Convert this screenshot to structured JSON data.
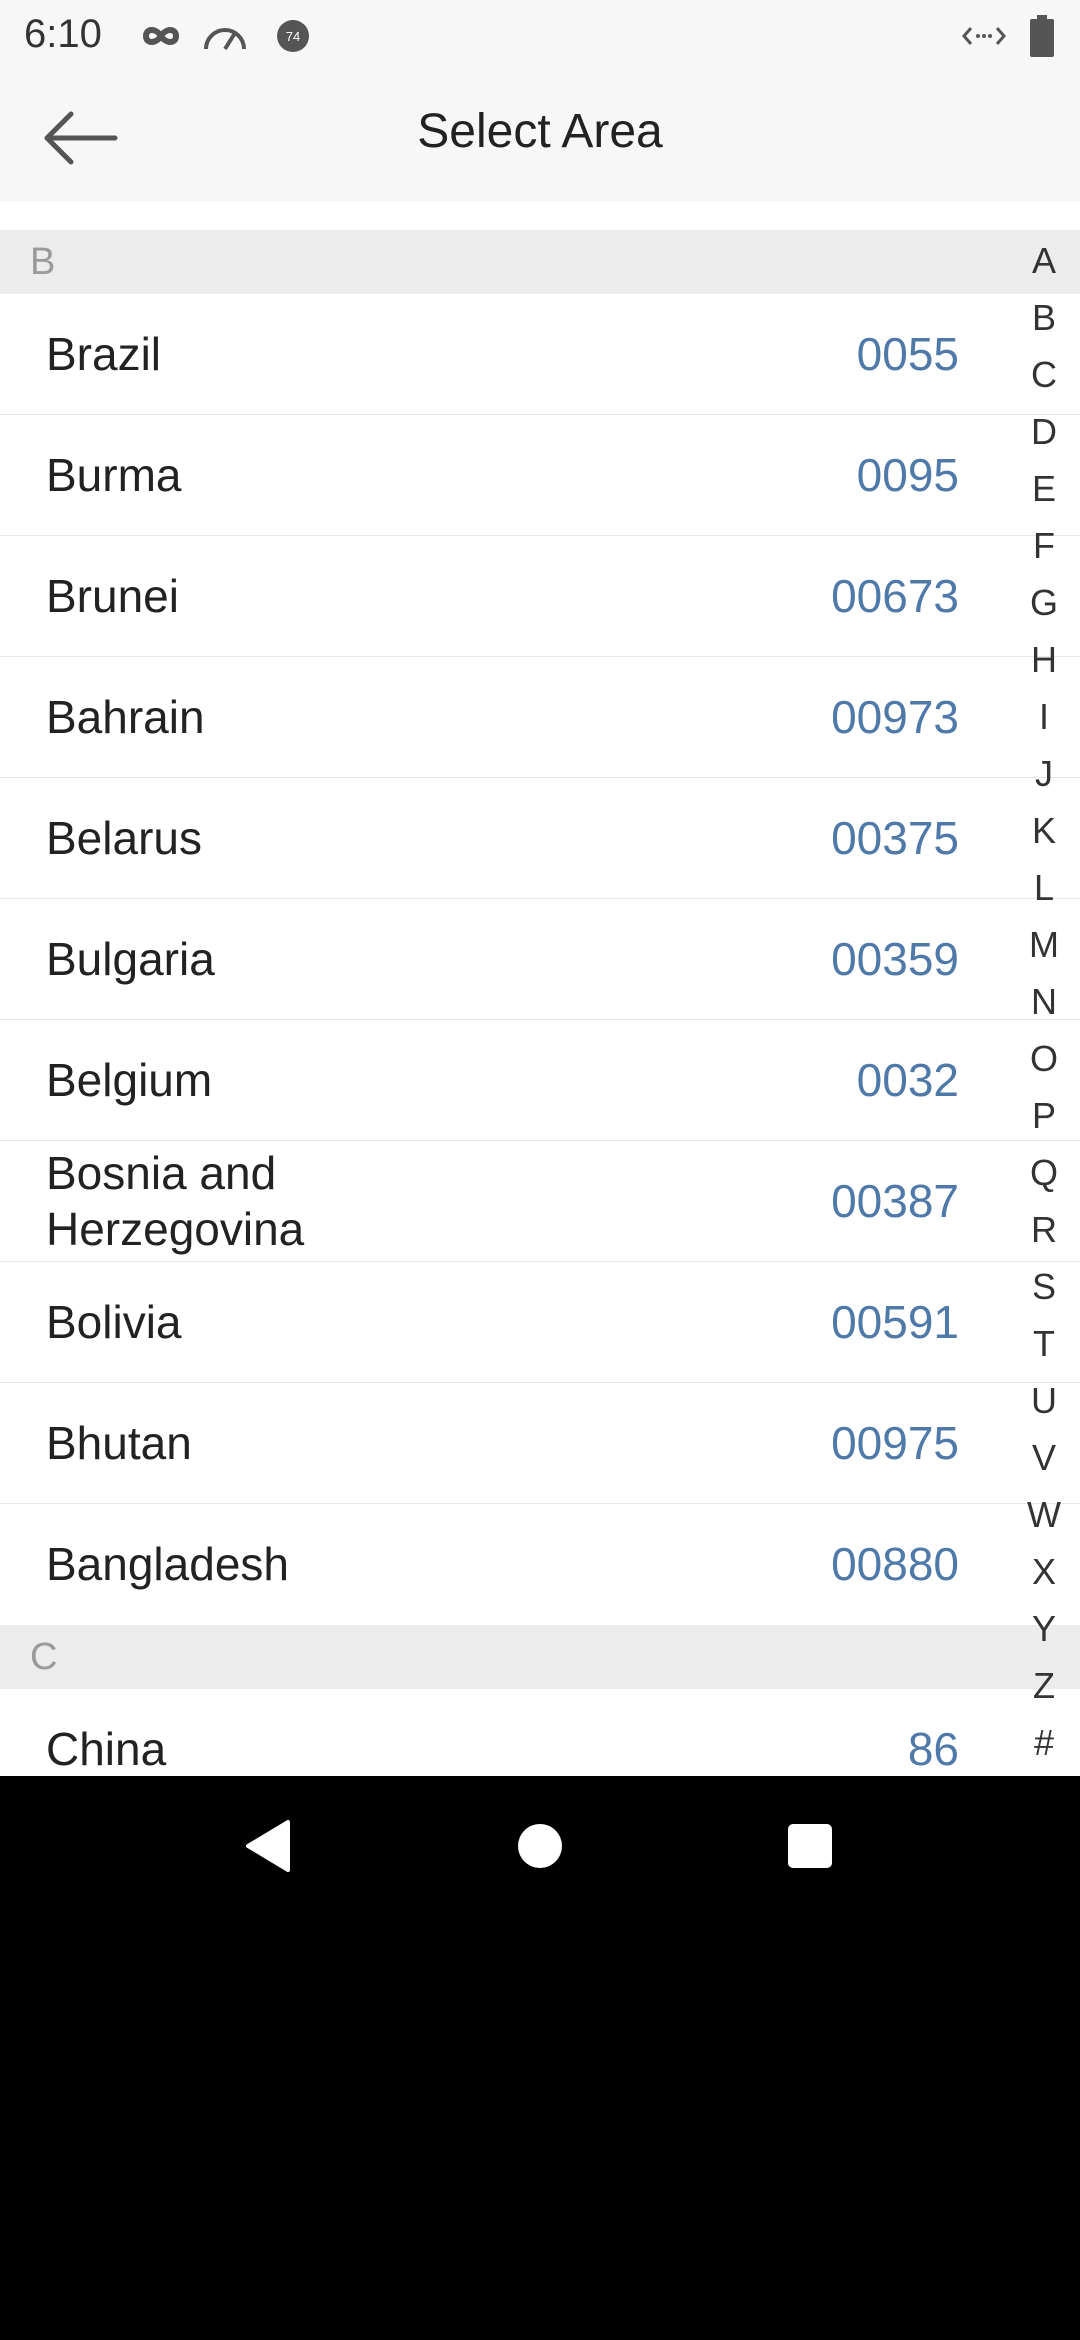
{
  "status_bar": {
    "time": "6:10",
    "icons_left": [
      "infinity-icon",
      "speedometer-icon",
      "notification-badge-icon"
    ],
    "icons_right": [
      "network-code-icon",
      "battery-icon"
    ]
  },
  "header": {
    "back_icon": "arrow-left-icon",
    "title": "Select Area"
  },
  "sections": [
    {
      "letter": "B",
      "items": [
        {
          "name": "Brazil",
          "code": "0055"
        },
        {
          "name": "Burma",
          "code": "0095"
        },
        {
          "name": "Brunei",
          "code": "00673"
        },
        {
          "name": "Bahrain",
          "code": "00973"
        },
        {
          "name": "Belarus",
          "code": "00375"
        },
        {
          "name": "Bulgaria",
          "code": "00359"
        },
        {
          "name": "Belgium",
          "code": "0032"
        },
        {
          "name": "Bosnia and Herzegovina",
          "code": "00387"
        },
        {
          "name": "Bolivia",
          "code": "00591"
        },
        {
          "name": "Bhutan",
          "code": "00975"
        },
        {
          "name": "Bangladesh",
          "code": "00880"
        }
      ]
    },
    {
      "letter": "C",
      "items": [
        {
          "name": "China",
          "code": "86"
        }
      ]
    }
  ],
  "index": [
    "A",
    "B",
    "C",
    "D",
    "E",
    "F",
    "G",
    "H",
    "I",
    "J",
    "K",
    "L",
    "M",
    "N",
    "O",
    "P",
    "Q",
    "R",
    "S",
    "T",
    "U",
    "V",
    "W",
    "X",
    "Y",
    "Z",
    "#"
  ],
  "nav_bar": {
    "back_icon": "triangle-back-icon",
    "home_icon": "circle-home-icon",
    "recents_icon": "square-recents-icon"
  },
  "colors": {
    "code_text": "#4f79a8",
    "section_bg": "#ececec",
    "header_bg": "#f7f7f7"
  }
}
